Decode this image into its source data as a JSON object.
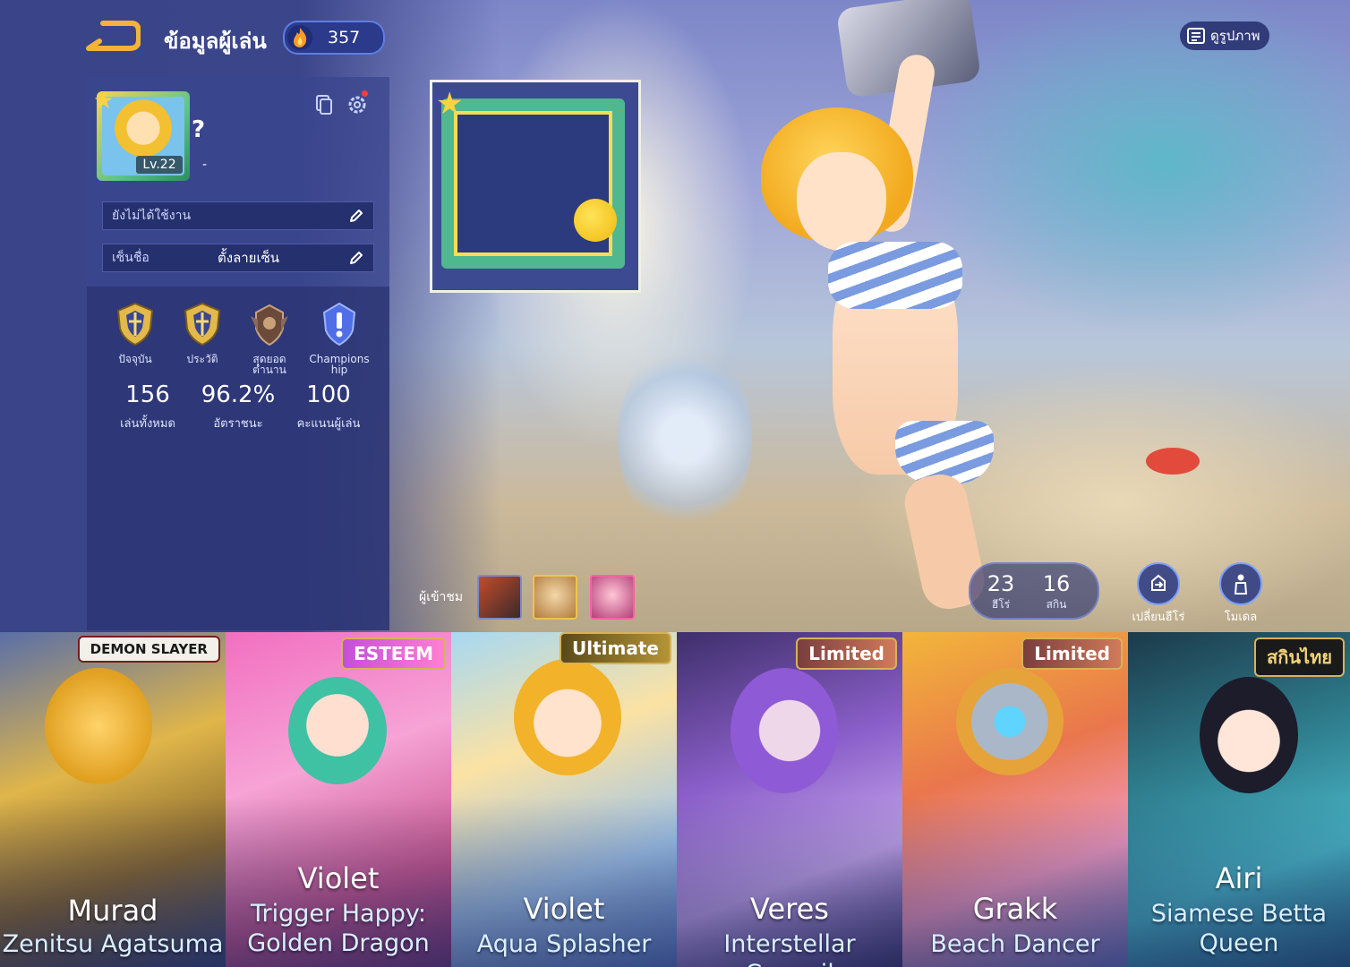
{
  "header": {
    "title": "ข้อมูลผู้เล่น",
    "fire_points": "357",
    "gallery_label": "ดูรูปภาพ"
  },
  "profile": {
    "level": "Lv.22",
    "name": "?",
    "dash": "-",
    "status_label": "ยังไม่ได้ใช้งาน",
    "signature_label": "เซ็นชื่อ",
    "signature_value": "ตั้งลายเซ็น"
  },
  "ranks": [
    {
      "label": "ปัจจุบัน"
    },
    {
      "label": "ประวัติ"
    },
    {
      "label": "สุดยอดตำนาน"
    },
    {
      "label": "Champions hip"
    }
  ],
  "stats": [
    {
      "value": "156",
      "label": "เล่นทั้งหมด"
    },
    {
      "value": "96.2%",
      "label": "อัตราชนะ"
    },
    {
      "value": "100",
      "label": "คะแนนผู้เล่น"
    }
  ],
  "visitors": {
    "label": "ผู้เข้าชม"
  },
  "counters": {
    "heroes_value": "23",
    "heroes_label": "ฮีโร่",
    "skins_value": "16",
    "skins_label": "สกิน"
  },
  "buttons": {
    "change_hero": "เปลี่ยนฮีโร่",
    "model": "โมเดล"
  },
  "skins": [
    {
      "hero": "Murad",
      "skin": "Zenitsu Agatsuma",
      "tag": "DEMON SLAYER"
    },
    {
      "hero": "Violet",
      "skin": "Trigger Happy: Golden Dragon",
      "tag": "ESTEEM"
    },
    {
      "hero": "Violet",
      "skin": "Aqua Splasher",
      "tag": "Ultimate"
    },
    {
      "hero": "Veres",
      "skin": "Interstellar Council",
      "tag": "Limited"
    },
    {
      "hero": "Grakk",
      "skin": "Beach Dancer",
      "tag": "Limited"
    },
    {
      "hero": "Airi",
      "skin": "Siamese Betta Queen",
      "tag": "สกินไทย"
    }
  ],
  "colors": {
    "panel": "#2e3676",
    "accent": "#5f7fe0",
    "gold": "#d7b25a"
  }
}
